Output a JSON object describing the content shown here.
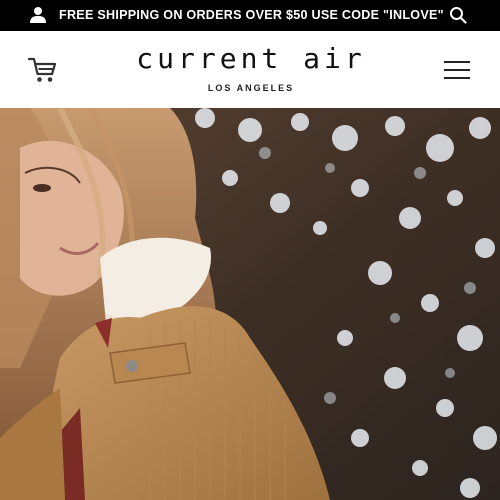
{
  "promo": {
    "text": "FREE SHIPPING ON ORDERS OVER $50 USE CODE \"INLOVE\"",
    "icons": {
      "left": "user-icon",
      "right": "search-icon"
    }
  },
  "header": {
    "logo_main": "current air",
    "logo_sub": "LOS ANGELES",
    "icons": {
      "left": "cart-icon",
      "right": "hamburger-menu-icon"
    }
  },
  "hero": {
    "subject": "model wearing tan corduroy jacket with sherpa collar"
  },
  "colors": {
    "promo_bg": "#000000",
    "promo_text": "#ffffff",
    "header_bg": "#ffffff"
  }
}
